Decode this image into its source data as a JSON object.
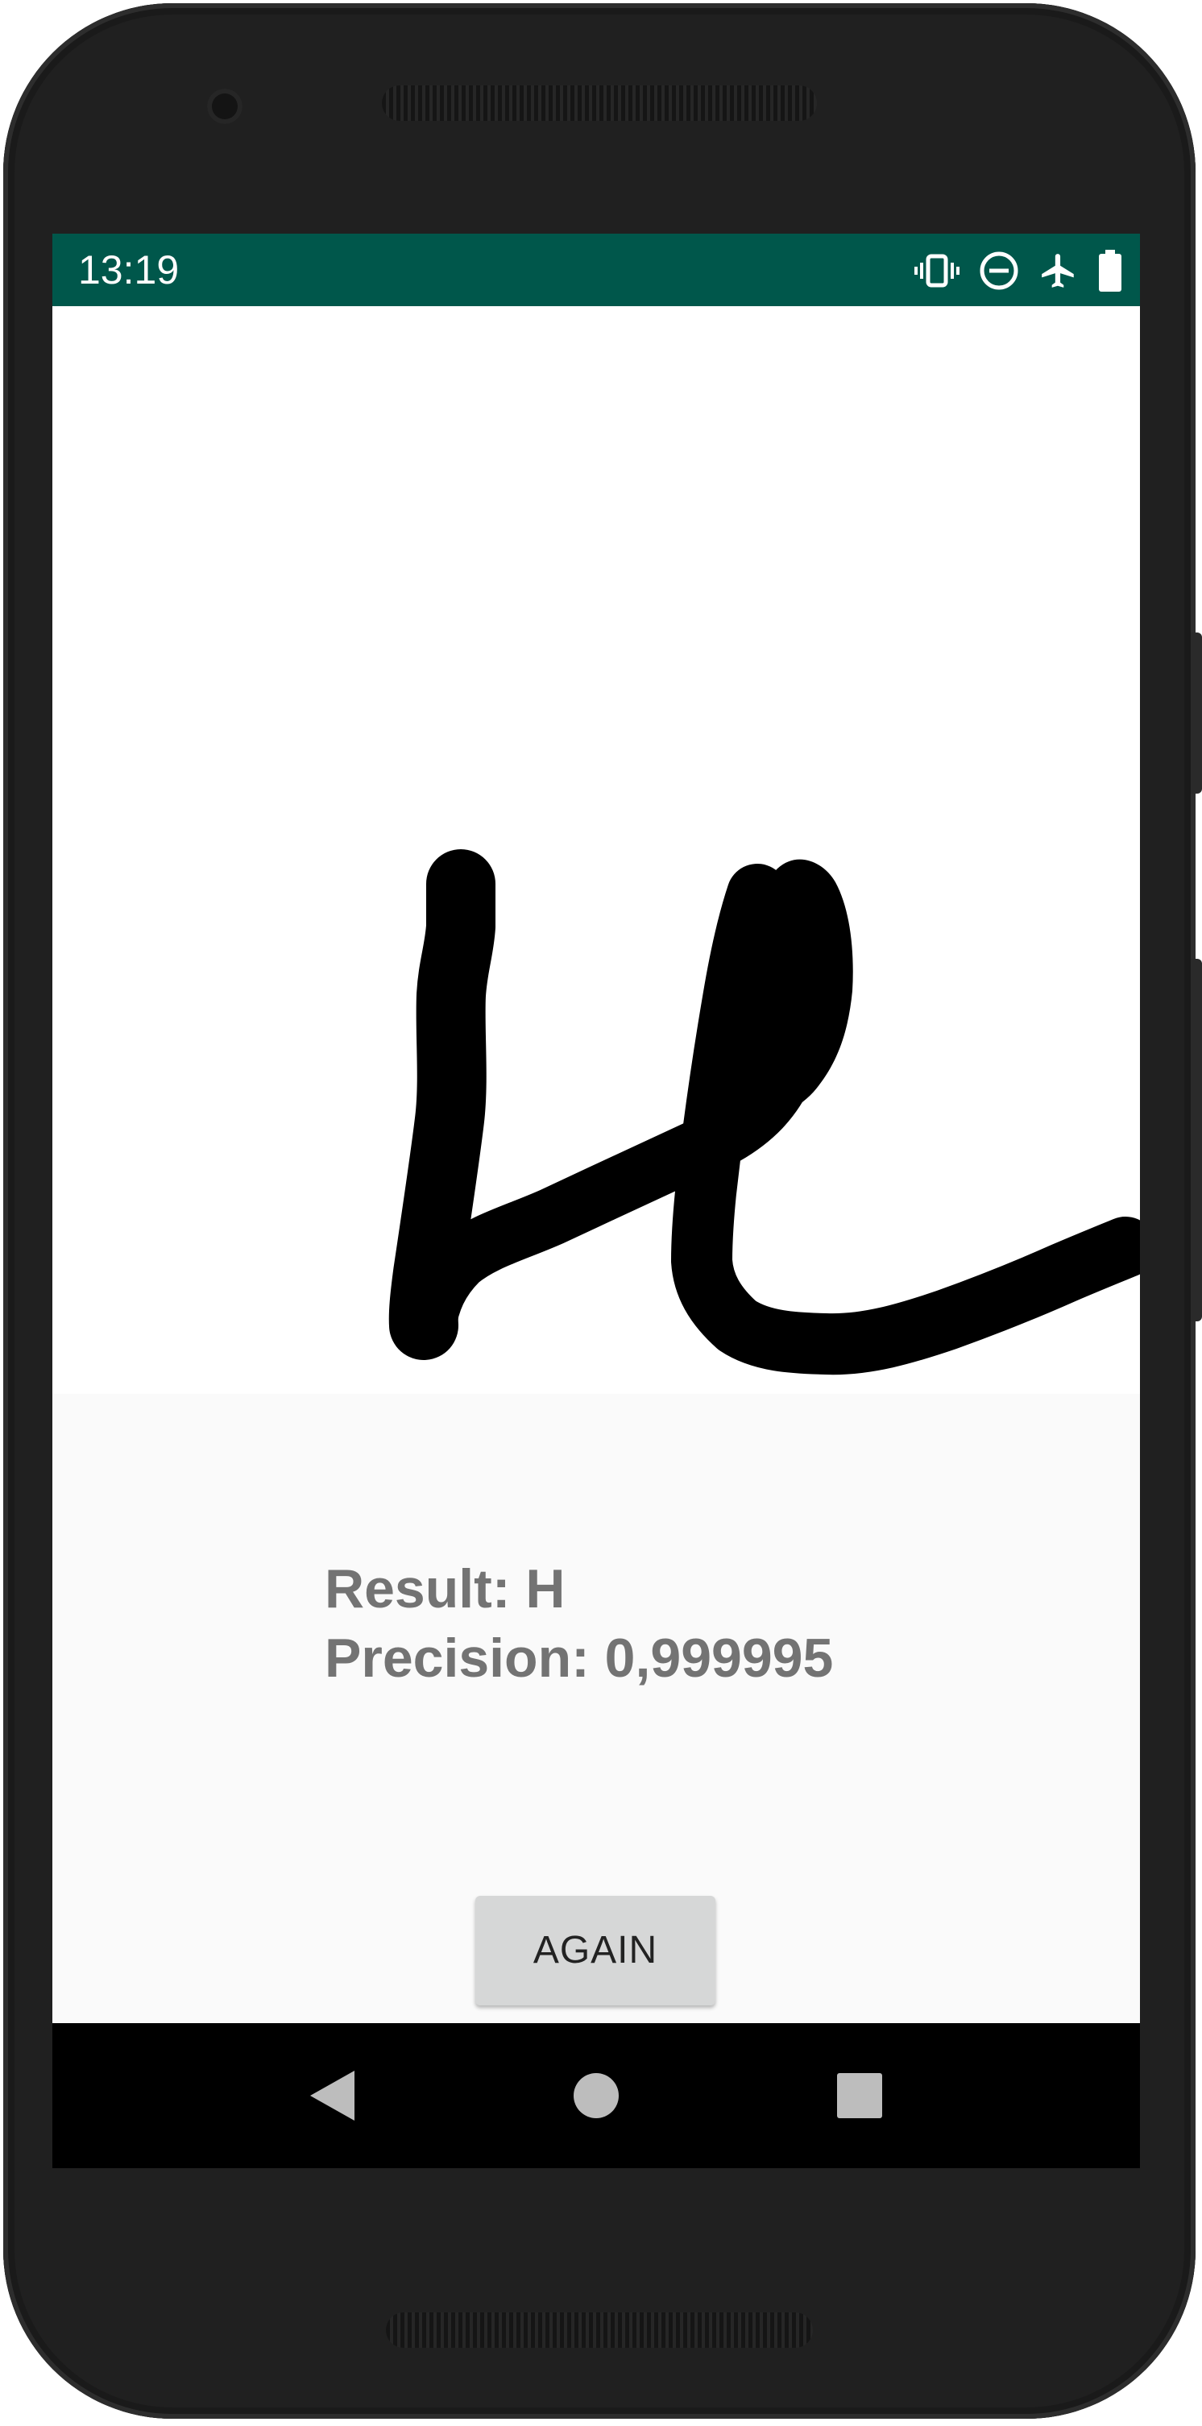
{
  "status_bar": {
    "time": "13:19",
    "icons": [
      "vibrate-icon",
      "do-not-disturb-icon",
      "airplane-mode-icon",
      "battery-icon"
    ]
  },
  "drawing": {
    "stroke_color": "#000000",
    "description_icon": "handwritten-stroke"
  },
  "result": {
    "result_text": "Result: H",
    "precision_text": "Precision: 0,999995"
  },
  "again_button": {
    "label": "AGAIN"
  },
  "nav_bar": {
    "icons": [
      "back-icon",
      "home-icon",
      "recents-icon"
    ]
  },
  "colors": {
    "status_bar": "#00574b",
    "result_text": "#737373",
    "button_bg": "#d6d7d7",
    "nav_bar": "#000000",
    "phone_body": "#202020"
  }
}
